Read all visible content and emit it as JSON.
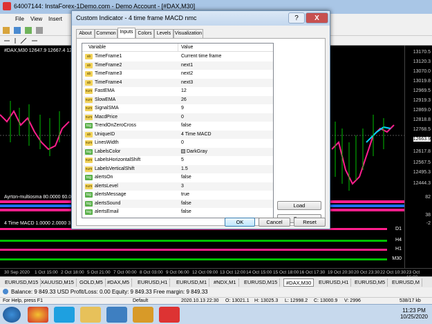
{
  "app": {
    "title": "64007144: InstaForex-1Demo.com - Demo Account - [#DAX,M30]",
    "menu": [
      "File",
      "View",
      "Insert"
    ]
  },
  "chart": {
    "symbol_label": "#DAX,M30  12647.9 12667.4 12647.1",
    "indicator1_label": "Ayrton-multiosma 80.0000 60.0000",
    "indicator2_label": "4 Time MACD 1.0000 2.0000 3.00",
    "prices": [
      "13170.5",
      "13120.3",
      "13070.0",
      "13019.8",
      "12969.5",
      "12919.3",
      "12869.0",
      "12818.8",
      "12768.5",
      "12718.3",
      "12663.9",
      "12617.8",
      "12567.5",
      "12495.3",
      "12444.3",
      "82",
      "38",
      "-2"
    ],
    "timeframes": [
      "D1",
      "H4",
      "H1",
      "M30"
    ],
    "times": [
      "30 Sep 2020",
      "1 Oct 15:00",
      "2 Oct 18:00",
      "5 Oct 21:00",
      "7 Oct 00:00",
      "8 Oct 03:00",
      "9 Oct 06:00",
      "12 Oct 09:00",
      "13 Oct 12:00",
      "14 Oct 15:00",
      "15 Oct 18:00",
      "16 Oct 17:30",
      "19 Oct 20:30",
      "20 Oct 23:30",
      "22 Oct 10:30",
      "23 Oct 16:30"
    ]
  },
  "symbol_tabs": [
    "EURUSD,M15",
    "XAUUSD,M15",
    "GOLD,M5",
    "#DAX,M5",
    "EURUSD,H1",
    "EURUSD,M1",
    "#NDX,M1",
    "EURUSD,M15",
    "#DAX,M30",
    "EURUSD,H1",
    "EURUSD,M5",
    "EURUSD,M"
  ],
  "terminal": {
    "balance_line": "Balance: 9 849.33 USD  Profit/Loss: 0.00  Equity: 9 849.33  Free margin: 9 849.33"
  },
  "statusbar": {
    "help": "For Help, press F1",
    "profile": "Default",
    "time": "2020.10.13 22:30",
    "open": "O: 13021.1",
    "high": "H: 13025.3",
    "low": "L: 12998.2",
    "close": "C: 13000.9",
    "vol": "V: 2996",
    "conn": "538/17 kb"
  },
  "taskbar": {
    "time": "11:23 PM",
    "date": "10/25/2020"
  },
  "dialog": {
    "title": "Custom Indicator - 4 time frame MACD nmc",
    "help_glyph": "?",
    "close_glyph": "X",
    "tabs": [
      "About",
      "Common",
      "Inputs",
      "Colors",
      "Levels",
      "Visualization"
    ],
    "selected_tab": "Inputs",
    "col_variable": "Variable",
    "col_value": "Value",
    "params": [
      {
        "icon": "ab",
        "name": "TimeFrame1",
        "value": "Current time frame"
      },
      {
        "icon": "ab",
        "name": "TimeFrame2",
        "value": "next1"
      },
      {
        "icon": "ab",
        "name": "TimeFrame3",
        "value": "next2"
      },
      {
        "icon": "ab",
        "name": "TimeFrame4",
        "value": "next3"
      },
      {
        "icon": "num",
        "name": "FastEMA",
        "value": "12"
      },
      {
        "icon": "num",
        "name": "SlowEMA",
        "value": "26"
      },
      {
        "icon": "num",
        "name": "SignalSMA",
        "value": "9"
      },
      {
        "icon": "num",
        "name": "MacdPrice",
        "value": "0"
      },
      {
        "icon": "tog",
        "name": "TrendOnZeroCross",
        "value": "false"
      },
      {
        "icon": "ab",
        "name": "UniqueID",
        "value": "4 Time MACD"
      },
      {
        "icon": "num",
        "name": "LinesWidth",
        "value": "0"
      },
      {
        "icon": "tog",
        "name": "LabelsColor",
        "value": "DarkGray"
      },
      {
        "icon": "num",
        "name": "LabelsHorizontalShift",
        "value": "5"
      },
      {
        "icon": "num",
        "name": "LabelsVerticalShift",
        "value": "1.5"
      },
      {
        "icon": "tog",
        "name": "alertsOn",
        "value": "false"
      },
      {
        "icon": "num",
        "name": "alertsLevel",
        "value": "3"
      },
      {
        "icon": "tog",
        "name": "alertsMessage",
        "value": "true"
      },
      {
        "icon": "tog",
        "name": "alertsSound",
        "value": "false"
      },
      {
        "icon": "tog",
        "name": "alertsEmail",
        "value": "false"
      }
    ],
    "load_label": "Load",
    "save_label": "Save",
    "ok_label": "OK",
    "cancel_label": "Cancel",
    "reset_label": "Reset"
  },
  "colors": {
    "accent": "#3c7fb1",
    "close_red": "#c75050",
    "macd_green": "#00c000",
    "macd_magenta": "#ff1e8c",
    "macd_cyan": "#00d4ff"
  }
}
